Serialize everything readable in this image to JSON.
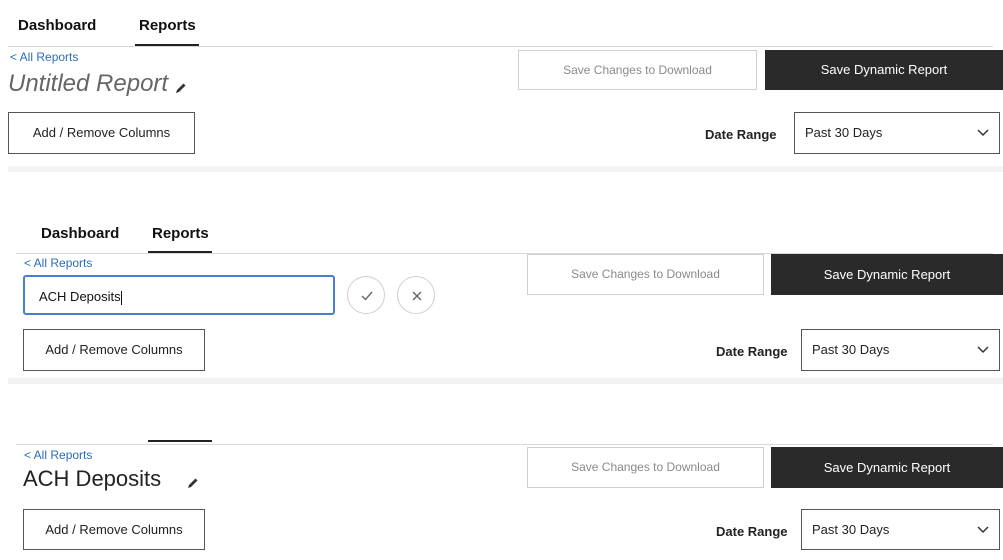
{
  "nav": {
    "tab_dashboard": "Dashboard",
    "tab_reports": "Reports"
  },
  "back_link": "< All Reports",
  "buttons": {
    "save_download": "Save Changes to Download",
    "save_dynamic": "Save Dynamic Report",
    "add_remove_columns": "Add / Remove Columns"
  },
  "date_range": {
    "label": "Date Range",
    "selected": "Past 30 Days"
  },
  "panel1": {
    "title": "Untitled Report"
  },
  "panel2": {
    "input_value": "ACH Deposits"
  },
  "panel3": {
    "title": "ACH Deposits"
  },
  "icons": [
    "pencil-icon",
    "check-icon",
    "close-icon",
    "chevron-down-icon"
  ]
}
